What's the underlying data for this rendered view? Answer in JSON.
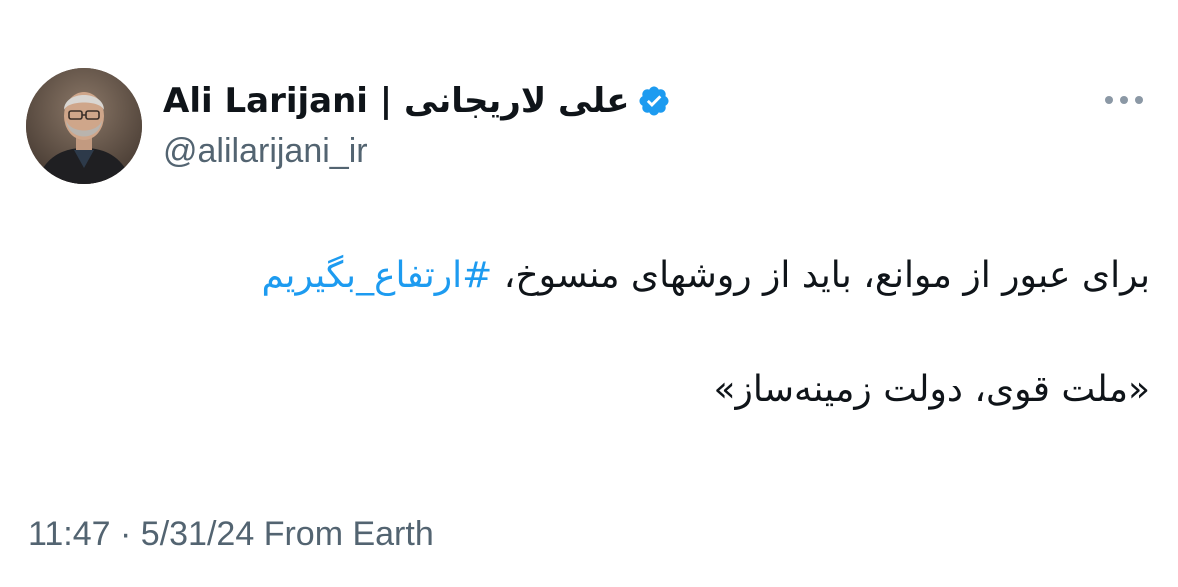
{
  "author": {
    "display_name": "علی لاریجانی | Ali Larijani",
    "handle": "@alilarijani_ir",
    "verified": true,
    "avatar_icon": "profile-photo"
  },
  "tweet": {
    "line1_text": "برای عبور از موانع، باید از روشهای منسوخ، ",
    "hashtag": "#ارتفاع_بگیریم",
    "line2_text": "«ملت قوی، دولت زمینه‌ساز»"
  },
  "meta": {
    "time": "11:47",
    "separator": "·",
    "date": "5/31/24",
    "source": "From Earth"
  },
  "colors": {
    "link": "#1d9bf0",
    "secondary_text": "#536471",
    "primary_text": "#0f1419",
    "verified_badge": "#1d9bf0"
  },
  "icons": {
    "more": "more-horizontal-icon",
    "verified": "verified-badge-icon"
  }
}
